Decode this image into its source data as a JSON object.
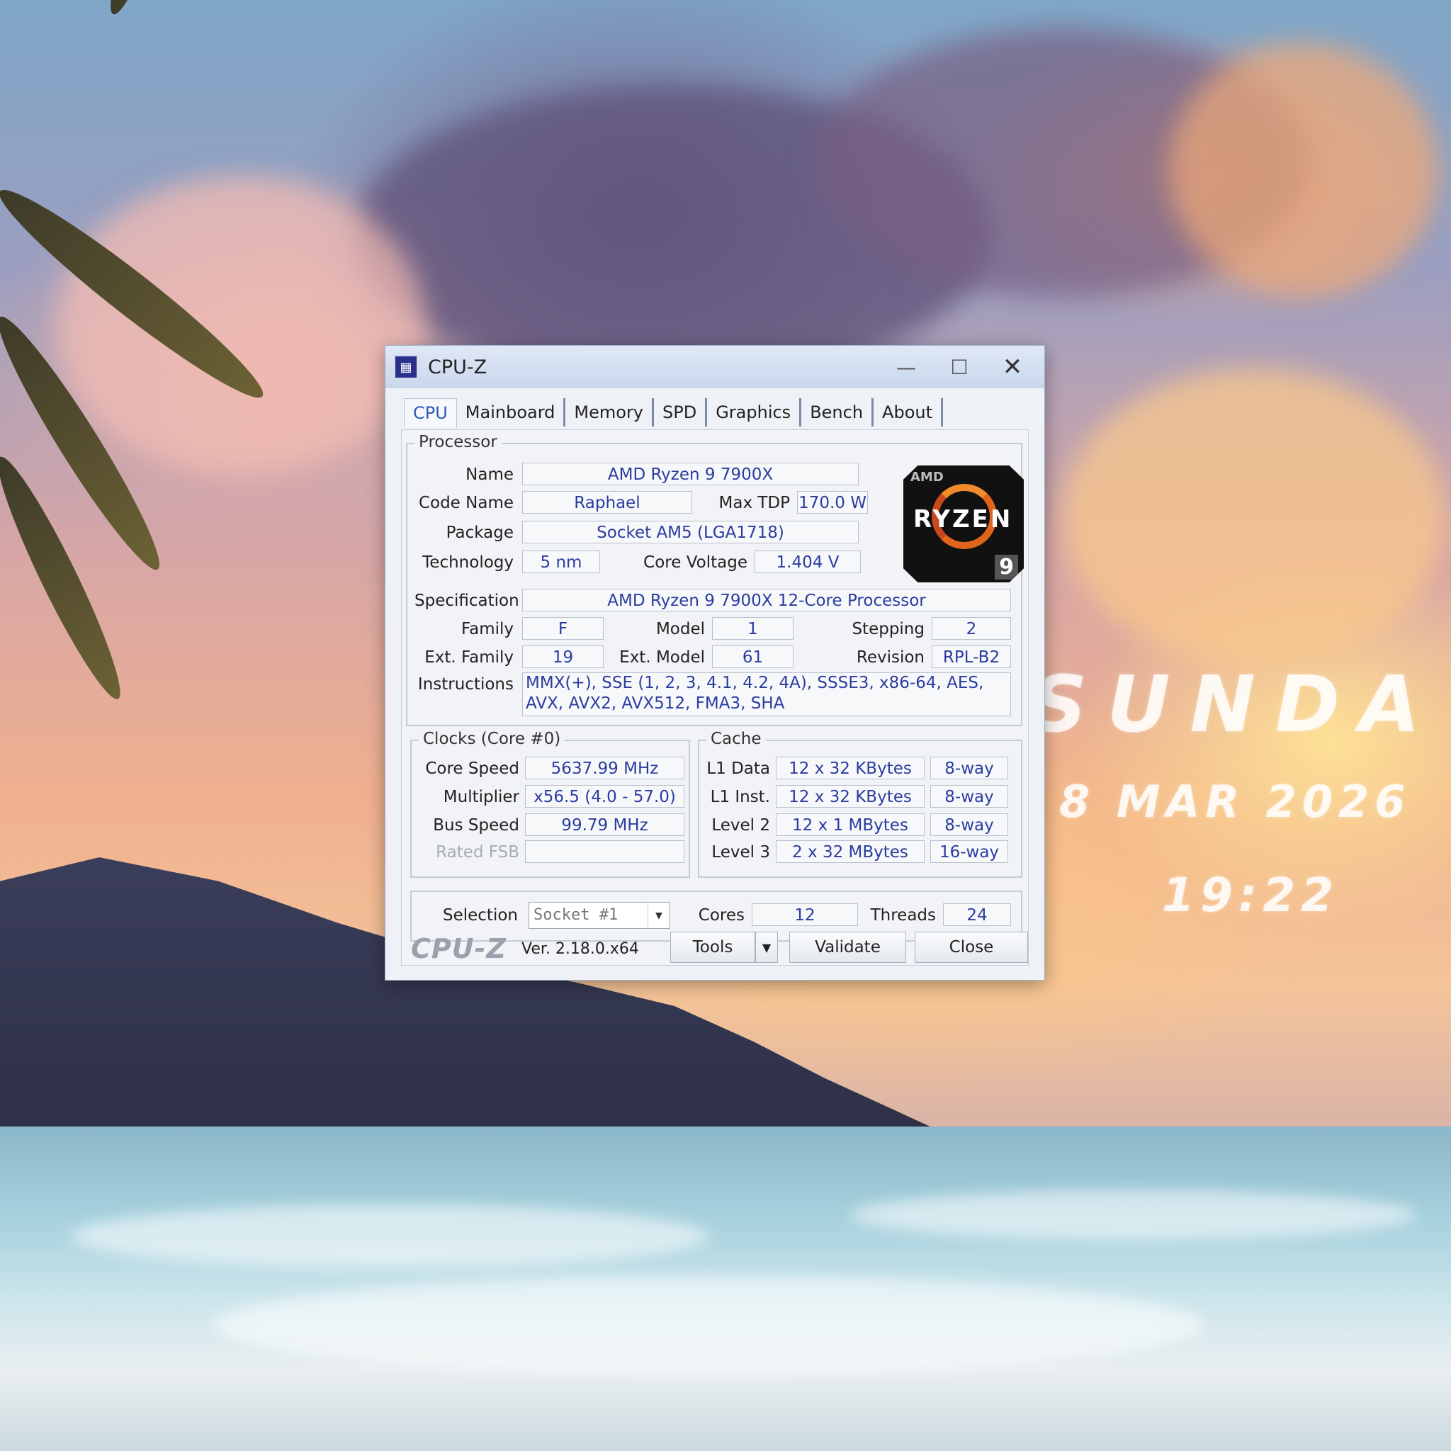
{
  "desktop": {
    "day": "SUNDA",
    "date": "8 MAR 2026",
    "time": "19:22"
  },
  "window": {
    "title": "CPU-Z",
    "tabs": [
      "CPU",
      "Mainboard",
      "Memory",
      "SPD",
      "Graphics",
      "Bench",
      "About"
    ],
    "active_tab": "CPU"
  },
  "processor": {
    "group_title": "Processor",
    "name_label": "Name",
    "name": "AMD Ryzen 9 7900X",
    "codename_label": "Code Name",
    "codename": "Raphael",
    "maxtdp_label": "Max TDP",
    "maxtdp": "170.0 W",
    "package_label": "Package",
    "package": "Socket AM5 (LGA1718)",
    "technology_label": "Technology",
    "technology": "5 nm",
    "corevoltage_label": "Core Voltage",
    "corevoltage": "1.404 V",
    "spec_label": "Specification",
    "spec": "AMD Ryzen 9 7900X 12-Core Processor",
    "family_label": "Family",
    "family": "F",
    "model_label": "Model",
    "model": "1",
    "stepping_label": "Stepping",
    "stepping": "2",
    "extfamily_label": "Ext. Family",
    "extfamily": "19",
    "extmodel_label": "Ext. Model",
    "extmodel": "61",
    "revision_label": "Revision",
    "revision": "RPL-B2",
    "instructions_label": "Instructions",
    "instructions": "MMX(+), SSE (1, 2, 3, 4.1, 4.2, 4A), SSSE3, x86-64, AES, AVX, AVX2, AVX512, FMA3, SHA",
    "logo": {
      "brand": "AMD",
      "word": "RYZEN",
      "tier": "9"
    }
  },
  "clocks": {
    "group_title": "Clocks (Core #0)",
    "corespeed_label": "Core Speed",
    "corespeed": "5637.99 MHz",
    "multiplier_label": "Multiplier",
    "multiplier": "x56.5 (4.0 - 57.0)",
    "busspeed_label": "Bus Speed",
    "busspeed": "99.79 MHz",
    "ratedfsb_label": "Rated FSB",
    "ratedfsb": ""
  },
  "cache": {
    "group_title": "Cache",
    "rows": [
      {
        "label": "L1 Data",
        "size": "12 x 32 KBytes",
        "way": "8-way"
      },
      {
        "label": "L1 Inst.",
        "size": "12 x 32 KBytes",
        "way": "8-way"
      },
      {
        "label": "Level 2",
        "size": "12 x 1 MBytes",
        "way": "8-way"
      },
      {
        "label": "Level 3",
        "size": "2 x 32 MBytes",
        "way": "16-way"
      }
    ]
  },
  "selection": {
    "label": "Selection",
    "value": "Socket #1",
    "cores_label": "Cores",
    "cores": "12",
    "threads_label": "Threads",
    "threads": "24"
  },
  "footer": {
    "brand": "CPU-Z",
    "version": "Ver. 2.18.0.x64",
    "tools_label": "Tools",
    "validate_label": "Validate",
    "close_label": "Close"
  },
  "colors": {
    "value_text": "#2b3ca0",
    "active_tab": "#2f5bb7",
    "logo_orange": "#e0641c"
  }
}
